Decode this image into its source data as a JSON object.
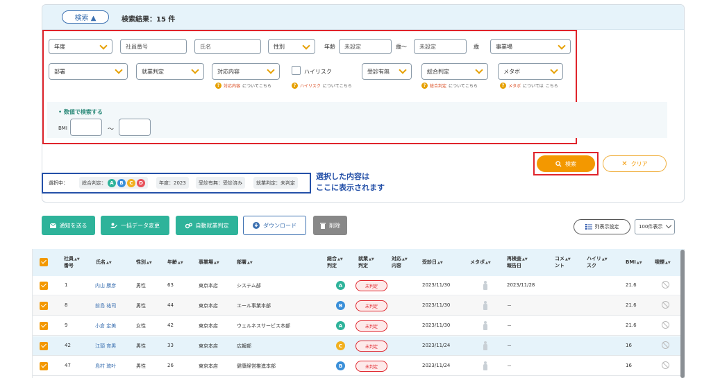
{
  "search_panel": {
    "toggle_label": "検索 ▲",
    "result_text": "検索結果：15 件",
    "filters": {
      "year": "年度",
      "employee_no": "社員番号",
      "name": "氏名",
      "gender": "性別",
      "age_label": "年齢",
      "age_from": "未設定",
      "age_sep": "歳～",
      "age_to": "未設定",
      "age_unit": "歳",
      "office": "事業場",
      "department": "部署",
      "work_judgment": "就業判定",
      "response": "対応内容",
      "high_risk": "ハイリスク",
      "exam_status": "受診有無",
      "overall": "総合判定",
      "metabo": "メタボ"
    },
    "help": {
      "response_accent": "対応内容",
      "high_risk_accent": "ハイリスク",
      "overall_accent": "総合判定",
      "metabo_accent": "メタボ",
      "suffix": "についてこちら",
      "suffix2": "については",
      "suffix2b": "こちら"
    },
    "numeric": {
      "title": "• 数値で検索する",
      "bmi_label": "BMI",
      "tilde": "～"
    },
    "search_button": "検索",
    "clear_button": "クリア",
    "selected": {
      "label": "選択中：",
      "overall_prefix": "総合判定：",
      "grades": [
        "A",
        "B",
        "C",
        "D"
      ],
      "chips": [
        "年度：2023",
        "受診有無：受診済み",
        "就業判定：未判定"
      ]
    },
    "annotation_line1": "選択した内容は",
    "annotation_line2": "ここに表示されます"
  },
  "actions": {
    "notify": "通知を送る",
    "bulk_change": "一括データ変更",
    "auto_judge": "自動就業判定",
    "download": "ダウンロード",
    "delete": "削除",
    "column_settings": "列表示設定",
    "per_page": "100件表示"
  },
  "table": {
    "headers": {
      "emp_no_1": "社員",
      "emp_no_2": "番号",
      "name": "氏名",
      "gender": "性別",
      "age": "年齢",
      "office": "事業場",
      "dept": "部署",
      "overall_1": "総合",
      "overall_2": "判定",
      "work_1": "就業",
      "work_2": "判定",
      "resp_1": "対応",
      "resp_2": "内容",
      "exam_date": "受診日",
      "metabo": "メタボ",
      "reexam_1": "再検査",
      "reexam_2": "報告日",
      "comment_1": "コメ",
      "comment_2": "ント",
      "risk_1": "ハイリ",
      "risk_2": "スク",
      "bmi": "BMI",
      "smoke": "喫煙"
    },
    "rows": [
      {
        "no": "1",
        "name": "内山 勝彦",
        "gender": "男性",
        "age": "63",
        "office": "東京本店",
        "dept": "システム部",
        "grade": "A",
        "work": "未判定",
        "date": "2023/11/30",
        "reexam": "2023/11/28",
        "bmi": "21.6"
      },
      {
        "no": "8",
        "name": "前島 祐司",
        "gender": "男性",
        "age": "44",
        "office": "東京本店",
        "dept": "エール事業本部",
        "grade": "B",
        "work": "未判定",
        "date": "2023/11/30",
        "reexam": "－",
        "bmi": "21.6"
      },
      {
        "no": "9",
        "name": "小倉 定美",
        "gender": "女性",
        "age": "42",
        "office": "東京本店",
        "dept": "ウェルネスサービス本部",
        "grade": "A",
        "work": "未判定",
        "date": "2023/11/30",
        "reexam": "－",
        "bmi": "21.6"
      },
      {
        "no": "42",
        "name": "江頭 育男",
        "gender": "男性",
        "age": "33",
        "office": "東京本店",
        "dept": "広報部",
        "grade": "C",
        "work": "未判定",
        "date": "2023/11/24",
        "reexam": "－",
        "bmi": "16"
      },
      {
        "no": "47",
        "name": "島村 琉叶",
        "gender": "男性",
        "age": "26",
        "office": "東京本店",
        "dept": "健康経営推進本部",
        "grade": "B",
        "work": "未判定",
        "date": "2023/11/24",
        "reexam": "－",
        "bmi": "16"
      }
    ]
  },
  "colors": {
    "grade_A": "#2eb39a",
    "grade_B": "#3a8fd9",
    "grade_C": "#f2b01e",
    "grade_D": "#e8515a",
    "accent": "#f39800",
    "highlight_red": "#e0242b",
    "highlight_blue": "#2450a8"
  }
}
